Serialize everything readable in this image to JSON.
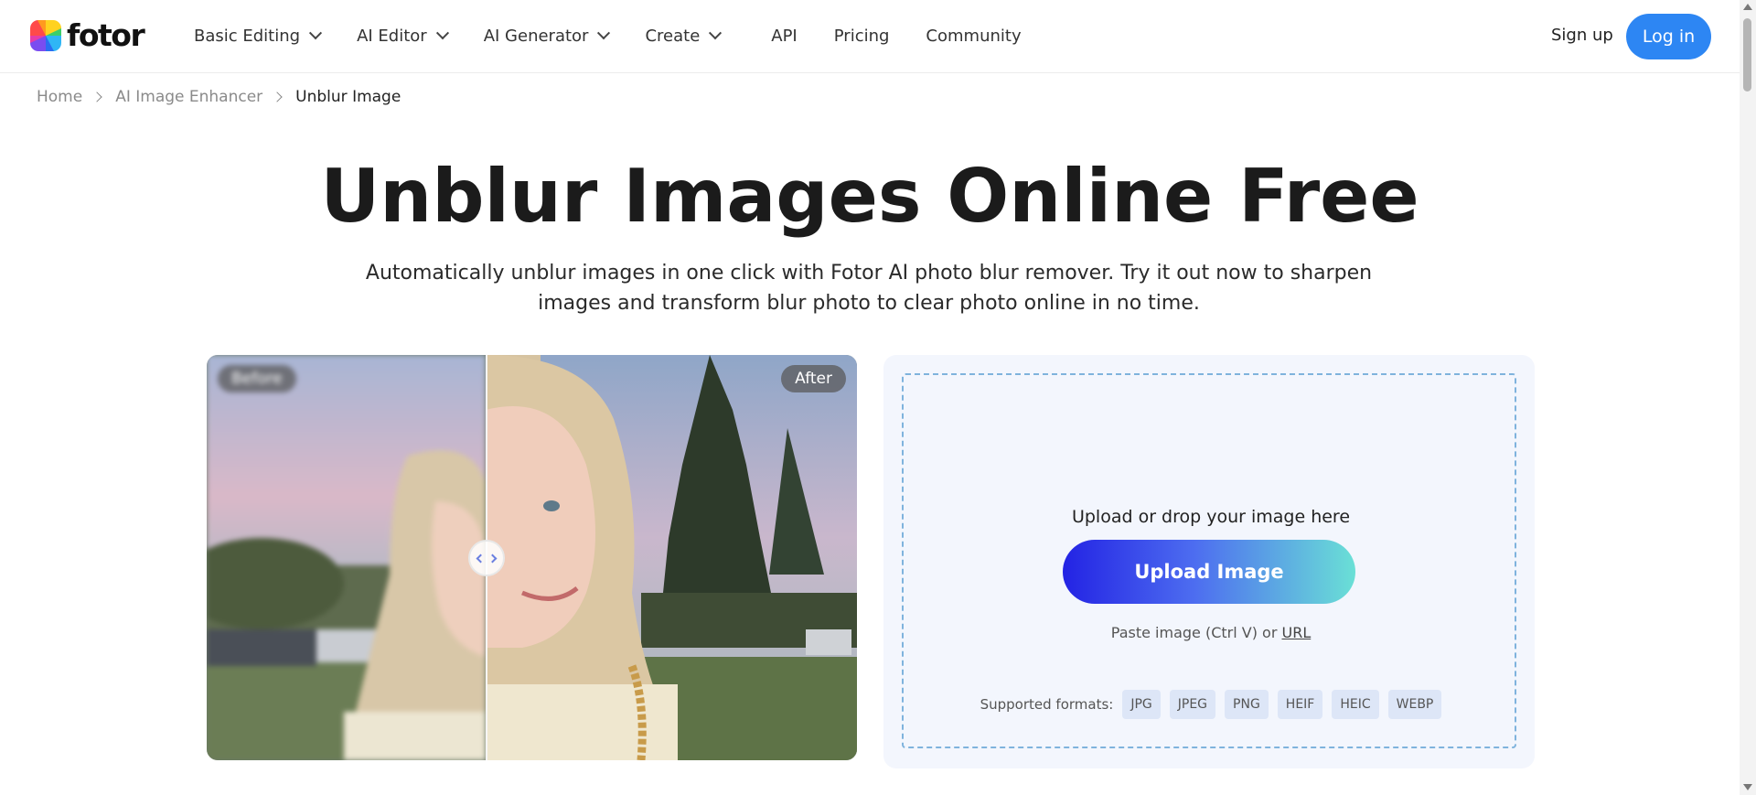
{
  "header": {
    "logo_text": "fotor",
    "nav": [
      {
        "label": "Basic Editing",
        "dropdown": true
      },
      {
        "label": "AI Editor",
        "dropdown": true
      },
      {
        "label": "AI Generator",
        "dropdown": true
      },
      {
        "label": "Create",
        "dropdown": true
      },
      {
        "label": "API",
        "dropdown": false
      },
      {
        "label": "Pricing",
        "dropdown": false
      },
      {
        "label": "Community",
        "dropdown": false
      }
    ],
    "signup_label": "Sign up",
    "login_label": "Log in",
    "login_color": "#2d86f3"
  },
  "breadcrumb": {
    "items": [
      "Home",
      "AI Image Enhancer",
      "Unblur Image"
    ]
  },
  "hero": {
    "title": "Unblur Images Online Free",
    "subtitle": "Automatically unblur images in one click with Fotor AI photo blur remover. Try it out now to sharpen images and transform blur photo to clear photo online in no time."
  },
  "compare": {
    "before_label": "Before",
    "after_label": "After"
  },
  "upload": {
    "prompt": "Upload or drop your image here",
    "button_label": "Upload Image",
    "paste_text": "Paste image (Ctrl V) or ",
    "url_label": "URL",
    "formats_label": "Supported formats:",
    "formats": [
      "JPG",
      "JPEG",
      "PNG",
      "HEIF",
      "HEIC",
      "WEBP"
    ]
  }
}
